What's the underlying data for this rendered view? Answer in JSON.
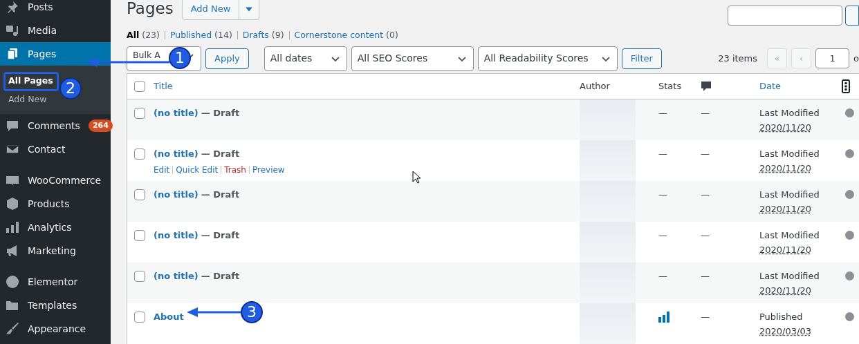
{
  "sidebar": {
    "groups": [
      [
        {
          "label": "Posts",
          "selected": false
        },
        {
          "label": "Media",
          "selected": false
        },
        {
          "label": "Pages",
          "selected": true,
          "children": [
            {
              "label": "All Pages",
              "selected": true
            },
            {
              "label": "Add New",
              "selected": false
            }
          ]
        },
        {
          "label": "Comments",
          "selected": false,
          "badge": "264"
        },
        {
          "label": "Contact",
          "selected": false
        }
      ],
      [
        {
          "label": "WooCommerce",
          "selected": false
        },
        {
          "label": "Products",
          "selected": false
        },
        {
          "label": "Analytics",
          "selected": false
        },
        {
          "label": "Marketing",
          "selected": false
        }
      ],
      [
        {
          "label": "Elementor",
          "selected": false
        },
        {
          "label": "Templates",
          "selected": false
        },
        {
          "label": "Appearance",
          "selected": false
        }
      ]
    ]
  },
  "header": {
    "title": "Pages",
    "add_new": "Add New"
  },
  "views": [
    {
      "label": "All",
      "count": "(23)",
      "selected": true
    },
    {
      "label": "Published",
      "count": "(14)",
      "selected": false
    },
    {
      "label": "Drafts",
      "count": "(9)",
      "selected": false
    },
    {
      "label": "Cornerstone content",
      "count": "(0)",
      "selected": false
    }
  ],
  "filters": {
    "bulk_action": "Bulk A",
    "apply": "Apply",
    "selects": [
      "All dates",
      "All SEO Scores",
      "All Readability Scores"
    ],
    "filter": "Filter"
  },
  "pagination": {
    "items": "23 items",
    "first": "«",
    "prev": "‹",
    "page": "1",
    "of": "o"
  },
  "table": {
    "select_all": {
      "checked": false
    },
    "columns": {
      "title": "Title",
      "author": "Author",
      "stats": "Stats",
      "date": "Date"
    },
    "rows": [
      {
        "checked": false,
        "title": "(no title)",
        "state": "— Draft",
        "stats": {
          "kind": "none",
          "text": "—"
        },
        "comments": "—",
        "date_status": "Last Modified",
        "date": "2020/11/20"
      },
      {
        "checked": false,
        "title": "(no title)",
        "state": "— Draft",
        "actions": [
          {
            "label": "Edit",
            "kind": "link"
          },
          {
            "label": "Quick Edit",
            "kind": "link"
          },
          {
            "label": "Trash",
            "kind": "danger"
          },
          {
            "label": "Preview",
            "kind": "link"
          }
        ],
        "stats": {
          "kind": "none",
          "text": "—"
        },
        "comments": "—",
        "date_status": "Last Modified",
        "date": "2020/11/20"
      },
      {
        "checked": false,
        "title": "(no title)",
        "state": "— Draft",
        "stats": {
          "kind": "none",
          "text": "—"
        },
        "comments": "—",
        "date_status": "Last Modified",
        "date": "2020/11/20"
      },
      {
        "checked": false,
        "title": "(no title)",
        "state": "— Draft",
        "stats": {
          "kind": "none",
          "text": "—"
        },
        "comments": "—",
        "date_status": "Last Modified",
        "date": "2020/11/20"
      },
      {
        "checked": false,
        "title": "(no title)",
        "state": "— Draft",
        "stats": {
          "kind": "none",
          "text": "—"
        },
        "comments": "—",
        "date_status": "Last Modified",
        "date": "2020/11/20"
      },
      {
        "checked": false,
        "title": "About",
        "stats": {
          "kind": "chart"
        },
        "comments": "—",
        "date_status": "Published",
        "date": "2020/03/03"
      }
    ]
  },
  "annotations": [
    "1",
    "2",
    "3"
  ]
}
